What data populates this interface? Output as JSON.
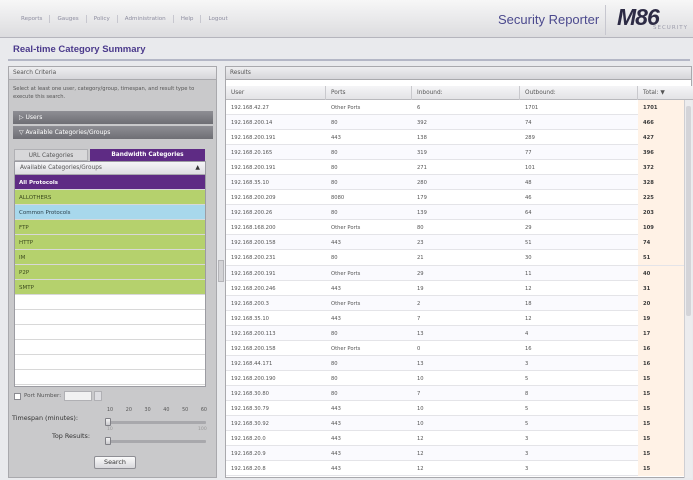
{
  "nav": [
    "Reports",
    "Gauges",
    "Policy",
    "Administration",
    "Help",
    "Logout"
  ],
  "app_title": "Security Reporter",
  "logo": {
    "text": "M86",
    "sub": "SECURITY"
  },
  "page_title": "Real-time Category Summary",
  "search": {
    "header": "Search Criteria",
    "instructions": "Select at least one user, category/group, timespan, and result type to execute this search.",
    "users_label": "▷ Users",
    "categories_label": "▽ Available Categories/Groups",
    "tabs": [
      "URL Categories",
      "Bandwidth Categories"
    ],
    "dropdown_label": "Available Categories/Groups",
    "categories": [
      {
        "name": "All Protocols",
        "style": "selected"
      },
      {
        "name": "ALLOTHERS",
        "style": "green"
      },
      {
        "name": "Common Protocols",
        "style": "blue"
      },
      {
        "name": "FTP",
        "style": "green"
      },
      {
        "name": "HTTP",
        "style": "green"
      },
      {
        "name": "IM",
        "style": "green"
      },
      {
        "name": "P2P",
        "style": "green"
      },
      {
        "name": "SMTP",
        "style": "green"
      },
      {
        "name": "",
        "style": "empty"
      },
      {
        "name": "",
        "style": "empty"
      },
      {
        "name": "",
        "style": "empty"
      },
      {
        "name": "",
        "style": "empty"
      },
      {
        "name": "",
        "style": "empty"
      },
      {
        "name": "",
        "style": "empty"
      }
    ],
    "port_label": "Port Number:",
    "timespan_label": "Timespan (minutes):",
    "timespan_ticks": [
      "10",
      "20",
      "30",
      "40",
      "50",
      "60"
    ],
    "top_results_label": "Top Results:",
    "top_min": "10",
    "top_max": "100",
    "search_button": "Search"
  },
  "results": {
    "header": "Results",
    "columns": [
      "User",
      "Ports",
      "Inbound:",
      "Outbound:",
      "Total: ▼"
    ],
    "rows": [
      [
        "192.168.42.27",
        "Other Ports",
        "6",
        "1701",
        "1701"
      ],
      [
        "192.168.200.14",
        "80",
        "392",
        "74",
        "466"
      ],
      [
        "192.168.200.191",
        "443",
        "138",
        "289",
        "427"
      ],
      [
        "192.168.20.165",
        "80",
        "319",
        "77",
        "396"
      ],
      [
        "192.168.200.191",
        "80",
        "271",
        "101",
        "372"
      ],
      [
        "192.168.35.10",
        "80",
        "280",
        "48",
        "328"
      ],
      [
        "192.168.200.209",
        "8080",
        "179",
        "46",
        "225"
      ],
      [
        "192.168.200.26",
        "80",
        "139",
        "64",
        "203"
      ],
      [
        "192.168.168.200",
        "Other Ports",
        "80",
        "29",
        "109"
      ],
      [
        "192.168.200.158",
        "443",
        "23",
        "51",
        "74"
      ],
      [
        "192.168.200.231",
        "80",
        "21",
        "30",
        "51"
      ],
      [
        "192.168.200.191",
        "Other Ports",
        "29",
        "11",
        "40"
      ],
      [
        "192.168.200.246",
        "443",
        "19",
        "12",
        "31"
      ],
      [
        "192.168.200.3",
        "Other Ports",
        "2",
        "18",
        "20"
      ],
      [
        "192.168.35.10",
        "443",
        "7",
        "12",
        "19"
      ],
      [
        "192.168.200.113",
        "80",
        "13",
        "4",
        "17"
      ],
      [
        "192.168.200.158",
        "Other Ports",
        "0",
        "16",
        "16"
      ],
      [
        "192.168.44.171",
        "80",
        "13",
        "3",
        "16"
      ],
      [
        "192.168.200.190",
        "80",
        "10",
        "5",
        "15"
      ],
      [
        "192.168.30.80",
        "80",
        "7",
        "8",
        "15"
      ],
      [
        "192.168.30.79",
        "443",
        "10",
        "5",
        "15"
      ],
      [
        "192.168.30.92",
        "443",
        "10",
        "5",
        "15"
      ],
      [
        "192.168.20.0",
        "443",
        "12",
        "3",
        "15"
      ],
      [
        "192.168.20.9",
        "443",
        "12",
        "3",
        "15"
      ],
      [
        "192.168.20.8",
        "443",
        "12",
        "3",
        "15"
      ]
    ]
  },
  "colors": {
    "accent": "#5e2b84",
    "category_green": "#b5d16d",
    "category_blue": "#a8d8ec",
    "total_bg": "#fff2e6"
  }
}
